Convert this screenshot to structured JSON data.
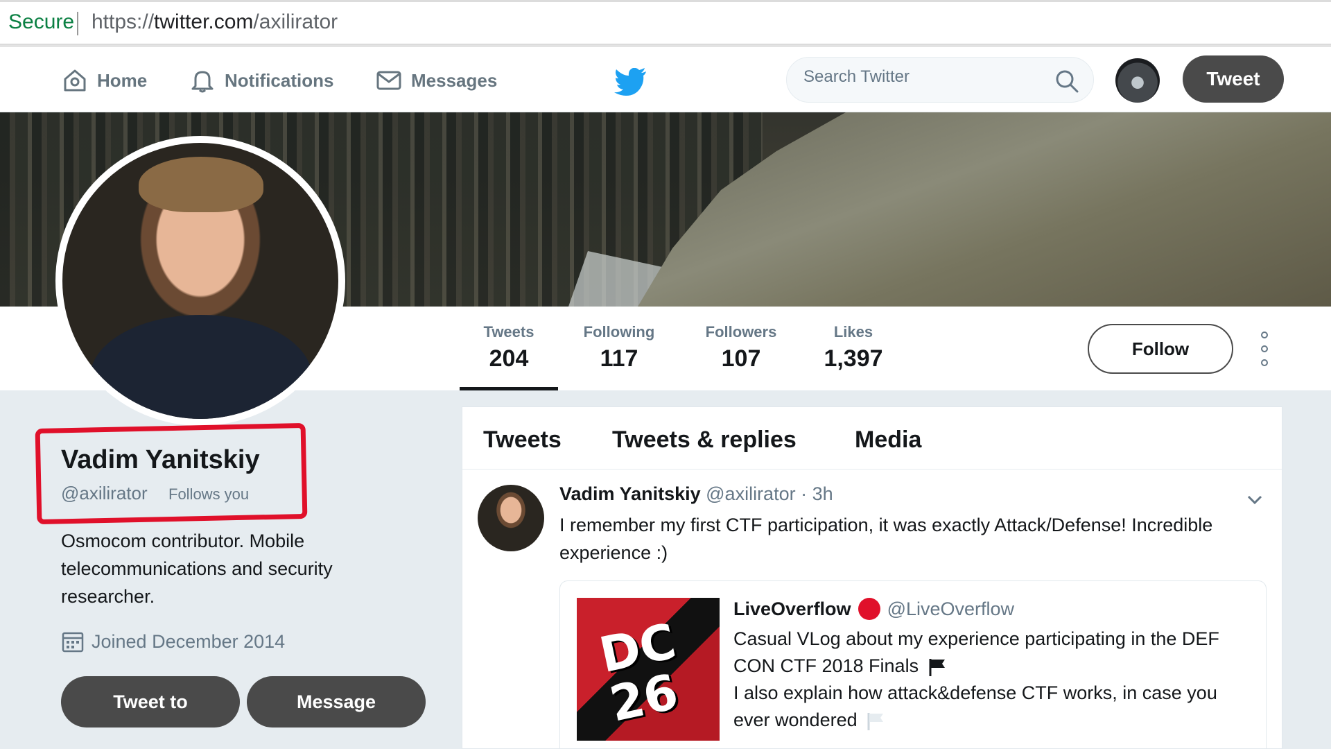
{
  "browser": {
    "secure_label": "Secure",
    "url_prefix": "https://",
    "url_host": "twitter.com",
    "url_path": "/axilirator"
  },
  "nav": {
    "home": "Home",
    "notifications": "Notifications",
    "messages": "Messages",
    "search_placeholder": "Search Twitter",
    "tweet_button": "Tweet"
  },
  "profile": {
    "name": "Vadim Yanitskiy",
    "handle": "@axilirator",
    "follows_you": "Follows you",
    "bio": "Osmocom contributor. Mobile telecommunications and security researcher.",
    "joined": "Joined December 2014",
    "tweet_to": "Tweet to",
    "message": "Message"
  },
  "stats": [
    {
      "label": "Tweets",
      "value": "204"
    },
    {
      "label": "Following",
      "value": "117"
    },
    {
      "label": "Followers",
      "value": "107"
    },
    {
      "label": "Likes",
      "value": "1,397"
    }
  ],
  "follow_button": "Follow",
  "tabs": [
    "Tweets",
    "Tweets & replies",
    "Media"
  ],
  "tweet": {
    "author": "Vadim Yanitskiy",
    "handle": "@axilirator",
    "time": "· 3h",
    "text": "I remember my first CTF participation, it was exactly Attack/Defense! Incredible experience :)",
    "quote": {
      "author": "LiveOverflow",
      "handle": "@LiveOverflow",
      "line1": "Casual VLog about my experience participating in the DEF CON CTF 2018 Finals",
      "line2": "I also explain how attack&defense CTF works, in case you ever wondered",
      "thumb_text": "DC 26"
    }
  },
  "colors": {
    "highlight_box": "#e0102a",
    "dark_button": "#4a4a4a",
    "secure_green": "#0b8043",
    "twitter_blue": "#1da1f2"
  },
  "icons": [
    "home-icon",
    "bell-icon",
    "envelope-icon",
    "twitter-bird-icon",
    "search-icon",
    "calendar-icon",
    "chevron-down-icon",
    "flag-icon",
    "more-vertical-icon"
  ]
}
